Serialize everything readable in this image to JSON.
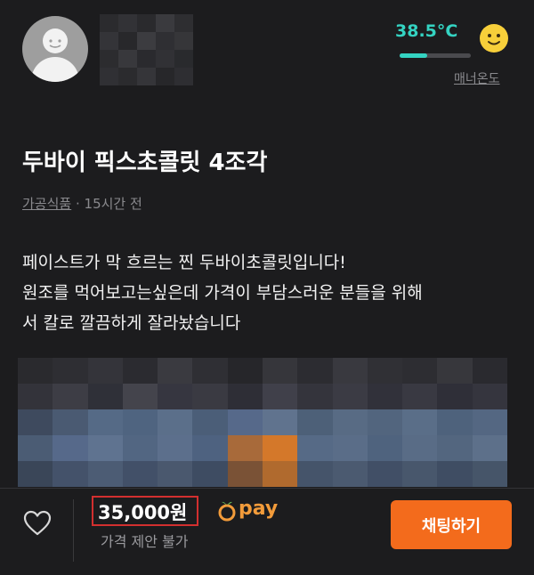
{
  "profile": {
    "avatar_icon": "default-user-avatar-icon",
    "manner_temperature": "38.5°C",
    "manner_temperature_level": 0.385,
    "manner_label": "매너온도",
    "temperature_face_icon": "smiling-face-icon",
    "temperature_color": "#34d3c2"
  },
  "listing": {
    "title": "두바이 픽스초콜릿 4조각",
    "category": "가공식품",
    "posted_time": "· 15시간 전",
    "description_lines": [
      "페이스트가 막 흐르는 찐 두바이초콜릿입니다!",
      "원조를 먹어보고는싶은데 가격이 부담스러운 분들을 위해",
      "서 칼로 깔끔하게 잘라놨습니다"
    ]
  },
  "bottom_bar": {
    "like_icon": "heart-outline-icon",
    "price": "35,000원",
    "pay_icon": "orange-pay-icon",
    "pay_label": "pay",
    "price_note": "가격 제안 불가",
    "chat_button": "채팅하기",
    "accent_color": "#f36b1c",
    "highlight_border_color": "#d32f2f"
  }
}
